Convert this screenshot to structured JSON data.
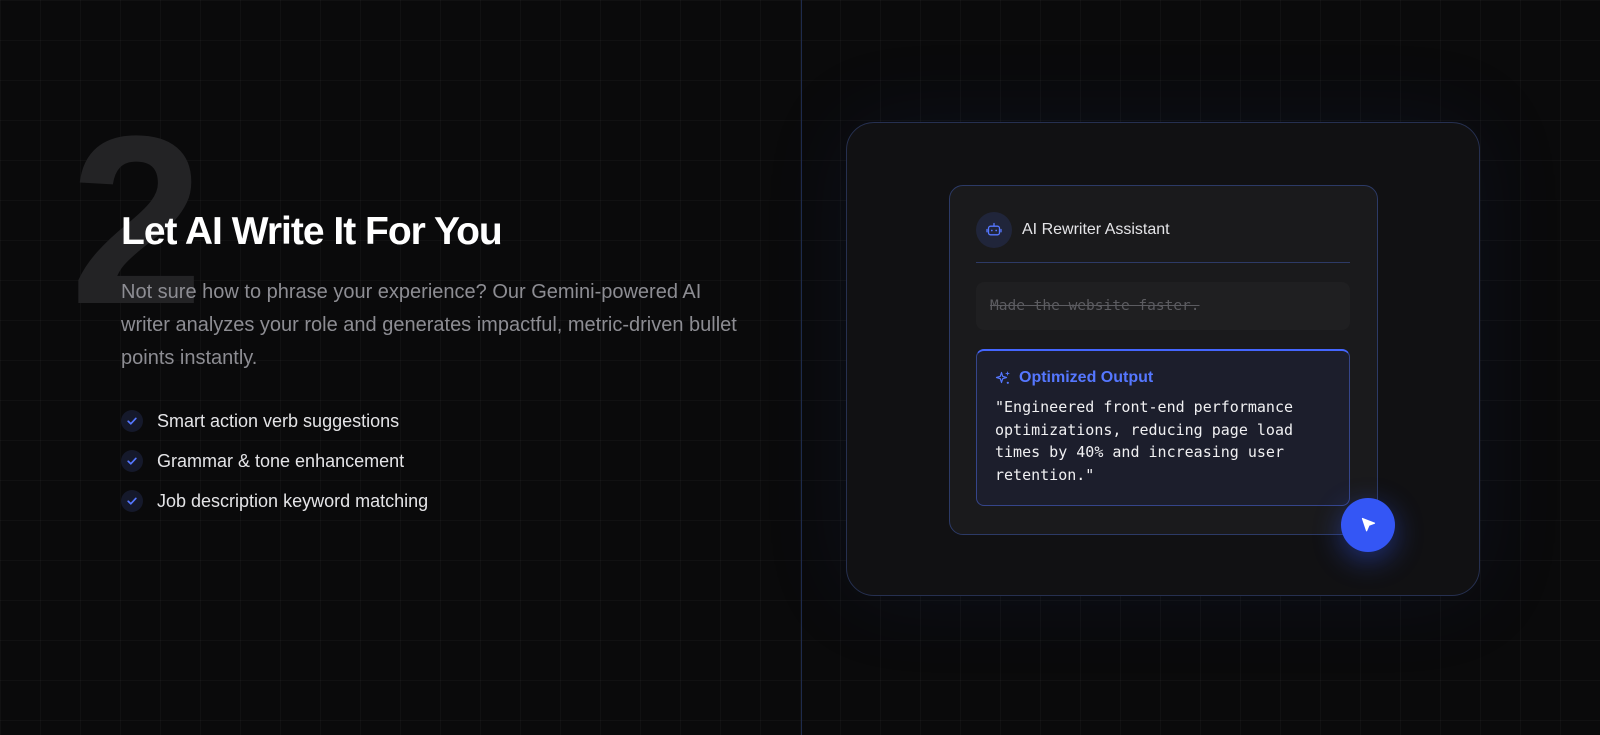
{
  "step": {
    "number": "2",
    "headline": "Let AI Write It For You",
    "description": "Not sure how to phrase your experience? Our Gemini-powered AI writer analyzes your role and generates impactful, metric-driven bullet points instantly.",
    "features": [
      {
        "label": "Smart action verb suggestions",
        "icon": "check-icon"
      },
      {
        "label": "Grammar & tone enhancement",
        "icon": "check-icon"
      },
      {
        "label": "Job description keyword matching",
        "icon": "check-icon"
      }
    ]
  },
  "assistant": {
    "title": "AI Rewriter Assistant",
    "avatar_icon": "robot-icon",
    "original_text": "Made the website faster.",
    "output_label": "Optimized Output",
    "output_icon": "sparkle-icon",
    "output_text": "\"Engineered front-end performance optimizations, reducing page load times by 40% and increasing user retention.\"",
    "action_icon": "cursor-icon"
  },
  "colors": {
    "accent": "#3456f5",
    "accent_text": "#5577ff",
    "background": "#0a0a0b",
    "card": "#111113",
    "border": "#263050"
  }
}
